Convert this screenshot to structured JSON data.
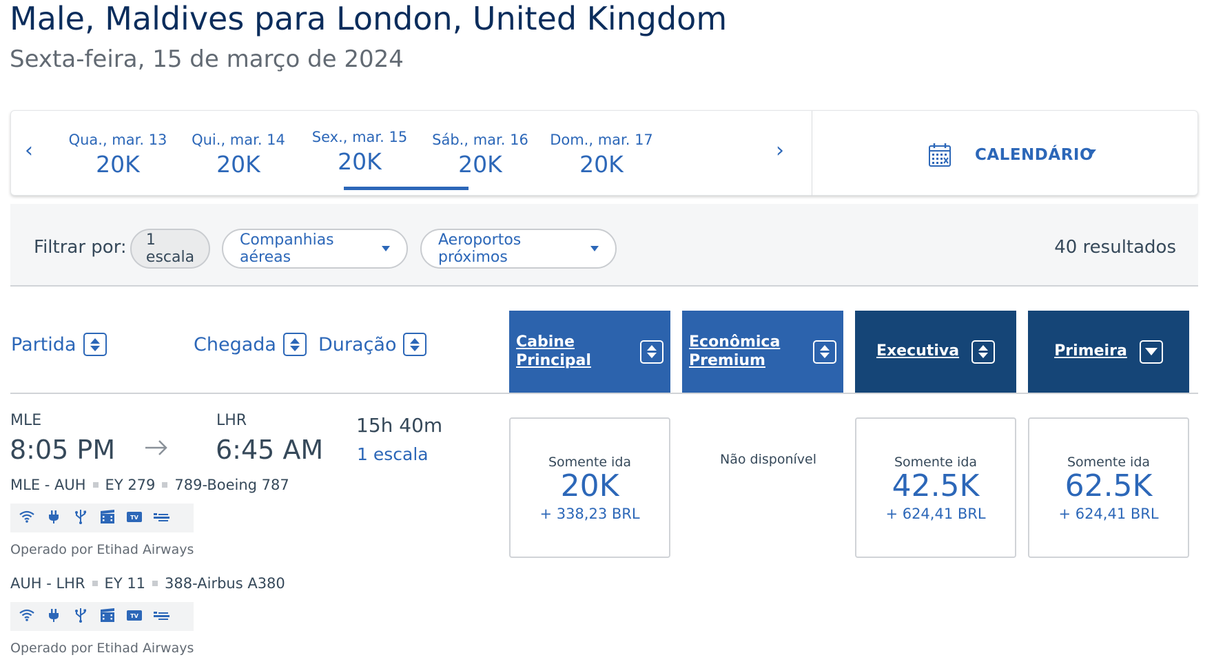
{
  "header": {
    "title": "Male, Maldives para London, United Kingdom",
    "subtitle": "Sexta-feira, 15 de março de 2024"
  },
  "date_nav": {
    "prev_icon": "chevron-left-icon",
    "next_icon": "chevron-right-icon",
    "prev": "‹",
    "next": "›",
    "dates": [
      {
        "label": "Qua., mar. 13",
        "price": "20K"
      },
      {
        "label": "Qui., mar. 14",
        "price": "20K"
      },
      {
        "label": "Sex., mar. 15",
        "price": "20K",
        "selected": true
      },
      {
        "label": "Sáb., mar. 16",
        "price": "20K"
      },
      {
        "label": "Dom., mar. 17",
        "price": "20K"
      }
    ],
    "calendar_label": "CALENDÁRIO",
    "calendar_icon": "calendar-icon"
  },
  "filters": {
    "label": "Filtrar por:",
    "stops": "1 escala",
    "airlines": "Companhias aéreas",
    "airports": "Aeroportos próximos",
    "results": "40 resultados"
  },
  "columns": {
    "departure": "Partida",
    "arrival": "Chegada",
    "duration": "Duração",
    "main_cabin": "Cabine Principal",
    "premium_economy": "Econômica Premium",
    "business": "Executiva",
    "first": "Primeira"
  },
  "flight": {
    "dep_code": "MLE",
    "dep_time": "8:05 PM",
    "arr_code": "LHR",
    "arr_time": "6:45 AM",
    "duration": "15h 40m",
    "stops": "1 escala",
    "segments": [
      {
        "route": "MLE - AUH",
        "flight": "EY 279",
        "aircraft": "789-Boeing 787",
        "operated": "Operado por Etihad Airways"
      },
      {
        "route": "AUH - LHR",
        "flight": "EY 11",
        "aircraft": "388-Airbus A380",
        "operated": "Operado por Etihad Airways"
      }
    ],
    "amenity_icons": [
      "wifi-icon",
      "power-outlet-icon",
      "usb-icon",
      "entertainment-icon",
      "tv-icon",
      "lie-flat-seat-icon"
    ],
    "fares": {
      "main_cabin": {
        "type": "Somente ida",
        "miles": "20K",
        "tax": "+ 338,23 BRL"
      },
      "premium_economy": {
        "unavailable": "Não disponível"
      },
      "business": {
        "type": "Somente ida",
        "miles": "42.5K",
        "tax": "+ 624,41 BRL"
      },
      "first": {
        "type": "Somente ida",
        "miles": "62.5K",
        "tax": "+ 624,41 BRL"
      }
    }
  },
  "colors": {
    "primary_blue": "#2c67b8",
    "header_light": "#2c63ad",
    "header_dark": "#154577",
    "title_navy": "#0b2d5c"
  }
}
